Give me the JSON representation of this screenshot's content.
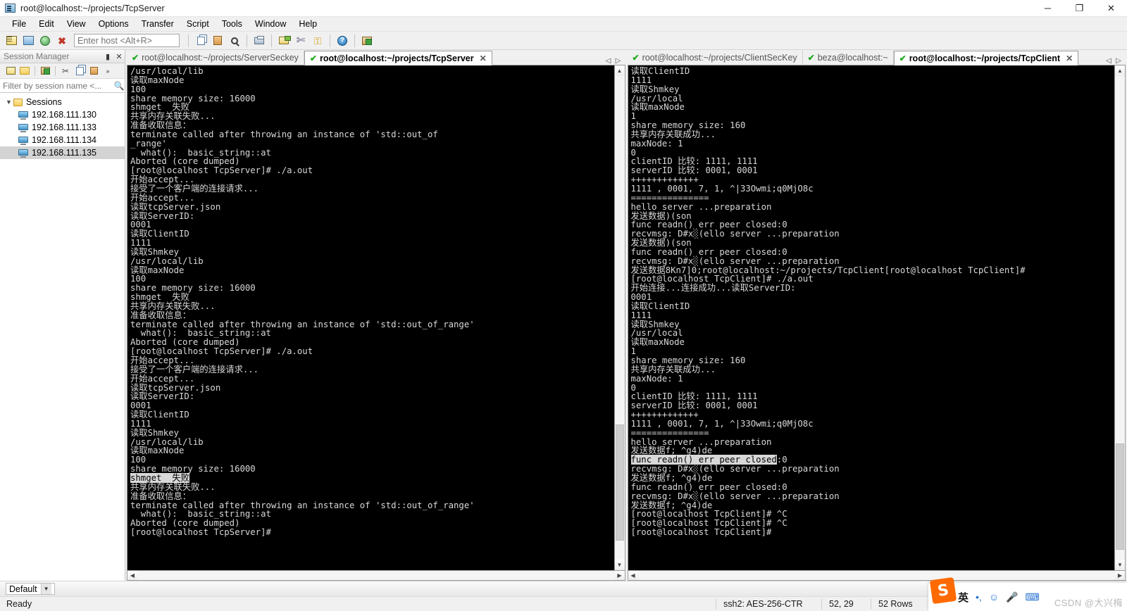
{
  "window": {
    "title": "root@localhost:~/projects/TcpServer",
    "app_icon": "securecrt-icon",
    "minimize_label": "─",
    "restore_label": "❐",
    "close_label": "✕"
  },
  "menubar": {
    "items": [
      {
        "label": "File",
        "name": "menu-file"
      },
      {
        "label": "Edit",
        "name": "menu-edit"
      },
      {
        "label": "View",
        "name": "menu-view"
      },
      {
        "label": "Options",
        "name": "menu-options"
      },
      {
        "label": "Transfer",
        "name": "menu-transfer"
      },
      {
        "label": "Script",
        "name": "menu-script"
      },
      {
        "label": "Tools",
        "name": "menu-tools"
      },
      {
        "label": "Window",
        "name": "menu-window"
      },
      {
        "label": "Help",
        "name": "menu-help"
      }
    ]
  },
  "toolbar": {
    "host_placeholder": "Enter host <Alt+R>",
    "host_value": "",
    "icons": [
      "session-manager-icon",
      "connect-icon",
      "connect-sftp-icon",
      "disconnect-icon",
      "copy-icon",
      "paste-icon",
      "find-icon",
      "print-icon",
      "log-session-icon",
      "clear-screen-icon",
      "key-icon",
      "help-icon",
      "session-options-icon"
    ]
  },
  "session_manager": {
    "title": "Session Manager",
    "pin_label": "▮",
    "close_label": "✕",
    "filter_placeholder": "Filter by session name <...",
    "filter_value": "",
    "search_icon": "search-icon",
    "tree_root": "Sessions",
    "sessions": [
      {
        "label": "192.168.111.130",
        "selected": false
      },
      {
        "label": "192.168.111.133",
        "selected": false
      },
      {
        "label": "192.168.111.134",
        "selected": false
      },
      {
        "label": "192.168.111.135",
        "selected": true
      }
    ],
    "toolbar_icons": [
      "new-session-icon",
      "new-folder-icon",
      "session-options-icon",
      "cut-icon",
      "copy-icon",
      "paste-icon",
      "more-icon"
    ]
  },
  "left_pane": {
    "tabs": [
      {
        "label": "root@localhost:~/projects/ServerSeckey",
        "active": false,
        "connected": true
      },
      {
        "label": "root@localhost:~/projects/TcpServer",
        "active": true,
        "connected": true
      }
    ],
    "tab_close_label": "✕",
    "nav_prev": "◁",
    "nav_next": "▷",
    "lines": [
      "/usr/local/lib",
      "读取maxNode",
      "100",
      "share memory size: 16000",
      "shmget  失败",
      "共享内存关联失败...",
      "准备收取信息：",
      "terminate called after throwing an instance of 'std::out_of",
      "_range'",
      "  what():  basic_string::at",
      "Aborted (core dumped)",
      "[root@localhost TcpServer]# ./a.out",
      "开始accept...",
      "接受了一个客户端的连接请求...",
      "开始accept...",
      "读取tcpServer.json",
      "读取ServerID:",
      "0001",
      "读取ClientID",
      "1111",
      "读取Shmkey",
      "/usr/local/lib",
      "读取maxNode",
      "100",
      "share memory size: 16000",
      "shmget  失败",
      "共享内存关联失败...",
      "准备收取信息：",
      "terminate called after throwing an instance of 'std::out_of_range'",
      "  what():  basic_string::at",
      "Aborted (core dumped)",
      "[root@localhost TcpServer]# ./a.out",
      "开始accept...",
      "接受了一个客户端的连接请求...",
      "开始accept...",
      "读取tcpServer.json",
      "读取ServerID:",
      "0001",
      "读取ClientID",
      "1111",
      "读取Shmkey",
      "/usr/local/lib",
      "读取maxNode",
      "100",
      "share memory size: 16000",
      "shmget  失败",
      "共享内存关联失败...",
      "准备收取信息：",
      "terminate called after throwing an instance of 'std::out_of_range'",
      "  what():  basic_string::at",
      "Aborted (core dumped)",
      "[root@localhost TcpServer]# "
    ],
    "highlighted_line_index": 45,
    "highlighted_text": "shmget  失败"
  },
  "right_pane": {
    "tabs": [
      {
        "label": "root@localhost:~/projects/ClientSecKey",
        "active": false,
        "connected": true
      },
      {
        "label": "beza@localhost:~",
        "active": false,
        "connected": true
      },
      {
        "label": "root@localhost:~/projects/TcpClient",
        "active": true,
        "connected": true
      }
    ],
    "tab_close_label": "✕",
    "nav_prev": "◁",
    "nav_next": "▷",
    "lines": [
      "读取ClientID",
      "1111",
      "读取Shmkey",
      "/usr/local",
      "读取maxNode",
      "1",
      "share memory size: 160",
      "共享内存关联成功...",
      "maxNode: 1",
      "0",
      "clientID 比较: 1111, 1111",
      "serverID 比较: 0001, 0001",
      "+++++++++++++",
      "1111 , 0001, 7, 1, ^|33Owmi;q0MjO8c",
      "===============",
      "hello server ...preparation",
      "发送数据)(son",
      "func readn() err peer closed:0",
      "recvmsg: D#x░(ello server ...preparation",
      "发送数据)(son",
      "func readn() err peer closed:0",
      "recvmsg: D#x░(ello server ...preparation",
      "发送数据8Kn7]0;root@localhost:~/projects/TcpClient[root@localhost TcpClient]#",
      "[root@localhost TcpClient]# ./a.out",
      "开始连接...连接成功...读取ServerID:",
      "0001",
      "读取ClientID",
      "1111",
      "读取Shmkey",
      "/usr/local",
      "读取maxNode",
      "1",
      "share memory size: 160",
      "共享内存关联成功...",
      "maxNode: 1",
      "0",
      "clientID 比较: 1111, 1111",
      "serverID 比较: 0001, 0001",
      "+++++++++++++",
      "1111 , 0001, 7, 1, ^|33Owmi;q0MjO8c",
      "===============",
      "hello server ...preparation",
      "发送数据f; ^g4)de",
      "func readn() err peer closed:0",
      "recvmsg: D#x░(ello server ...preparation",
      "发送数据f; ^g4)de",
      "func readn() err peer closed:0",
      "recvmsg: D#x░(ello server ...preparation",
      "发送数据f; ^g4)de",
      "[root@localhost TcpClient]# ^C",
      "[root@localhost TcpClient]# ^C",
      "[root@localhost TcpClient]#"
    ],
    "highlighted_line_index": 43,
    "highlighted_text": "func readn() err peer closed"
  },
  "bottom_bar": {
    "session_label": "Default",
    "dropdown_icon": "chevron-down-icon"
  },
  "statusbar": {
    "ready": "Ready",
    "cipher": "ssh2: AES-256-CTR",
    "cursor_pos": "52, 29",
    "rows": "52 Rows"
  },
  "ime": {
    "logo": "S",
    "mode": "英",
    "punct": "•,",
    "emoji_icon": "emoji-icon",
    "mic_icon": "microphone-icon",
    "keyboard_icon": "keyboard-icon",
    "watermark": "CSDN @大兴梅"
  },
  "colors": {
    "accent": "#1f6fd0",
    "terminal_bg": "#000000",
    "terminal_fg": "#d8d8d8",
    "tab_connected": "#1faa1f",
    "selection": "#d8d8d8"
  }
}
